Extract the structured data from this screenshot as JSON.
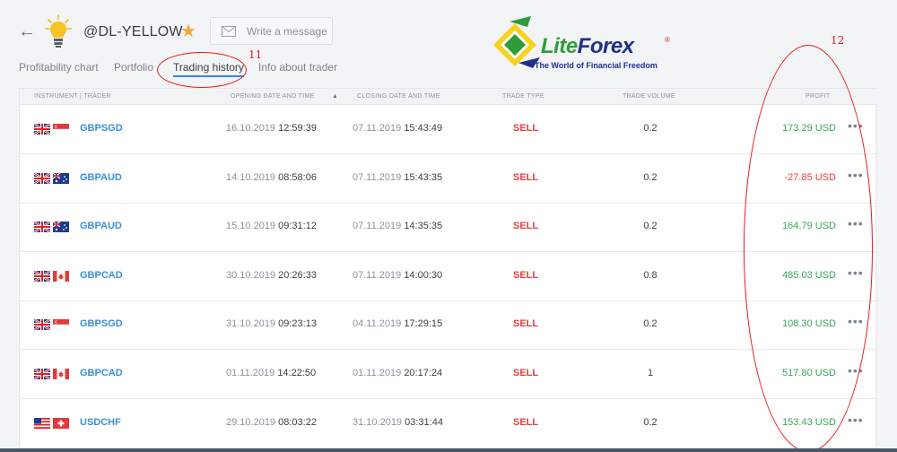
{
  "header": {
    "back_icon": "arrow-left-icon",
    "avatar_icon": "lightbulb-icon",
    "trader_name": "@DL-YELLOW",
    "favorite_icon": "star-icon",
    "message_placeholder": "Write a message"
  },
  "tabs": [
    {
      "label": "Profitability chart",
      "active": false
    },
    {
      "label": "Portfolio",
      "active": false
    },
    {
      "label": "Trading history",
      "active": true
    },
    {
      "label": "Info about trader",
      "active": false
    }
  ],
  "annotations": {
    "a11": "11",
    "a12": "12"
  },
  "logo": {
    "brand_lite": "Lite",
    "brand_forex": "Forex",
    "reg": "®",
    "tagline": "The World of Financial Freedom"
  },
  "table": {
    "headers": {
      "instrument": "INSTRUMENT | TRADER",
      "opening": "OPENING DATE AND TIME",
      "closing": "CLOSING DATE AND TIME",
      "type": "TRADE TYPE",
      "volume": "TRADE VOLUME",
      "profit": "PROFIT"
    },
    "sort_indicator": "▲",
    "rows": [
      {
        "flags": [
          "gb",
          "sg"
        ],
        "instrument": "GBPSGD",
        "open_date": "16.10.2019",
        "open_time": "12:59:39",
        "close_date": "07.11.2019",
        "close_time": "15:43:49",
        "type": "SELL",
        "volume": "0.2",
        "profit": "173.29 USD",
        "sign": "pos"
      },
      {
        "flags": [
          "gb",
          "au"
        ],
        "instrument": "GBPAUD",
        "open_date": "14.10.2019",
        "open_time": "08:58:06",
        "close_date": "07.11.2019",
        "close_time": "15:43:35",
        "type": "SELL",
        "volume": "0.2",
        "profit": "-27.85 USD",
        "sign": "neg"
      },
      {
        "flags": [
          "gb",
          "au"
        ],
        "instrument": "GBPAUD",
        "open_date": "15.10.2019",
        "open_time": "09:31:12",
        "close_date": "07.11.2019",
        "close_time": "14:35:35",
        "type": "SELL",
        "volume": "0.2",
        "profit": "164.79 USD",
        "sign": "pos"
      },
      {
        "flags": [
          "gb",
          "ca"
        ],
        "instrument": "GBPCAD",
        "open_date": "30.10.2019",
        "open_time": "20:26:33",
        "close_date": "07.11.2019",
        "close_time": "14:00:30",
        "type": "SELL",
        "volume": "0.8",
        "profit": "485.03 USD",
        "sign": "pos"
      },
      {
        "flags": [
          "gb",
          "sg"
        ],
        "instrument": "GBPSGD",
        "open_date": "31.10.2019",
        "open_time": "09:23:13",
        "close_date": "04.11.2019",
        "close_time": "17:29:15",
        "type": "SELL",
        "volume": "0.2",
        "profit": "108.30 USD",
        "sign": "pos"
      },
      {
        "flags": [
          "gb",
          "ca"
        ],
        "instrument": "GBPCAD",
        "open_date": "01.11.2019",
        "open_time": "14:22:50",
        "close_date": "01.11.2019",
        "close_time": "20:17:24",
        "type": "SELL",
        "volume": "1",
        "profit": "517.80 USD",
        "sign": "pos"
      },
      {
        "flags": [
          "us",
          "ch"
        ],
        "instrument": "USDCHF",
        "open_date": "29.10.2019",
        "open_time": "08:03:22",
        "close_date": "31.10.2019",
        "close_time": "03:31:44",
        "type": "SELL",
        "volume": "0.2",
        "profit": "153.43 USD",
        "sign": "pos"
      }
    ],
    "more_label": "•••"
  },
  "colors": {
    "accent": "#3b82f6",
    "positive": "#3aa657",
    "negative": "#e53e3e",
    "link": "#3b8fd8",
    "annotation": "#e31b1b"
  }
}
